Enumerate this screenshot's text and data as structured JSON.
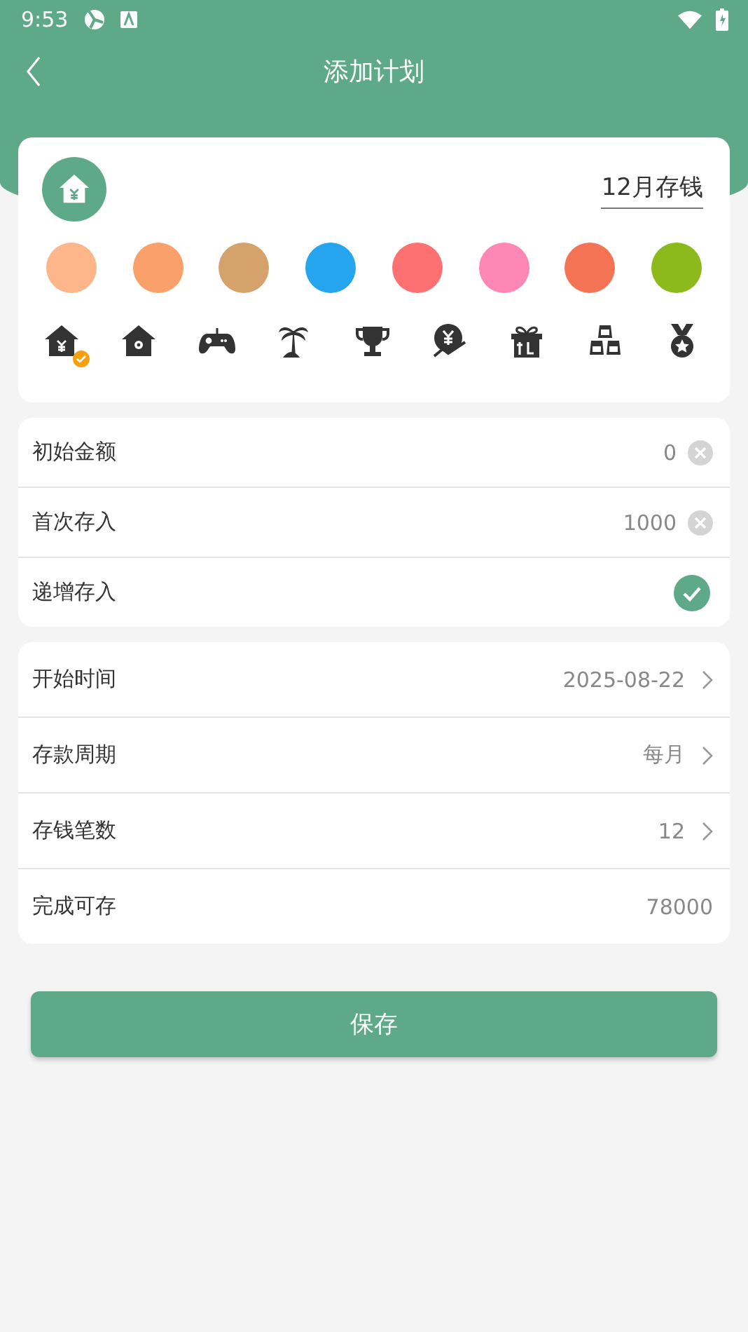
{
  "status_bar": {
    "time": "9:53"
  },
  "title": "添加计划",
  "plan": {
    "name": "12月存钱"
  },
  "colors": [
    {
      "color": "#fdb68a"
    },
    {
      "color": "#f9a06b"
    },
    {
      "color": "#d6a26b"
    },
    {
      "color": "#25a5ee"
    },
    {
      "color": "#fe7172"
    },
    {
      "color": "#fe87b6"
    },
    {
      "color": "#f47354"
    },
    {
      "color": "#8cba1c"
    }
  ],
  "icons": [
    {
      "kind": "house-yen",
      "selected": true
    },
    {
      "kind": "house",
      "selected": false
    },
    {
      "kind": "gamepad",
      "selected": false
    },
    {
      "kind": "palm",
      "selected": false
    },
    {
      "kind": "trophy",
      "selected": false
    },
    {
      "kind": "yen-coin",
      "selected": false
    },
    {
      "kind": "gift",
      "selected": false
    },
    {
      "kind": "gold",
      "selected": false
    },
    {
      "kind": "medal",
      "selected": false
    }
  ],
  "amount_rows": [
    {
      "kind": "input",
      "label": "初始金额",
      "value": "0"
    },
    {
      "kind": "input",
      "label": "首次存入",
      "value": "1000"
    },
    {
      "kind": "toggle",
      "label": "递增存入",
      "checked": true
    }
  ],
  "schedule_rows": [
    {
      "label": "开始时间",
      "value": "2025-08-22",
      "chevron": true
    },
    {
      "label": "存款周期",
      "value": "每月",
      "chevron": true
    },
    {
      "label": "存钱笔数",
      "value": "12",
      "chevron": true
    },
    {
      "label": "完成可存",
      "value": "78000",
      "chevron": false
    }
  ],
  "save_button": "保存"
}
